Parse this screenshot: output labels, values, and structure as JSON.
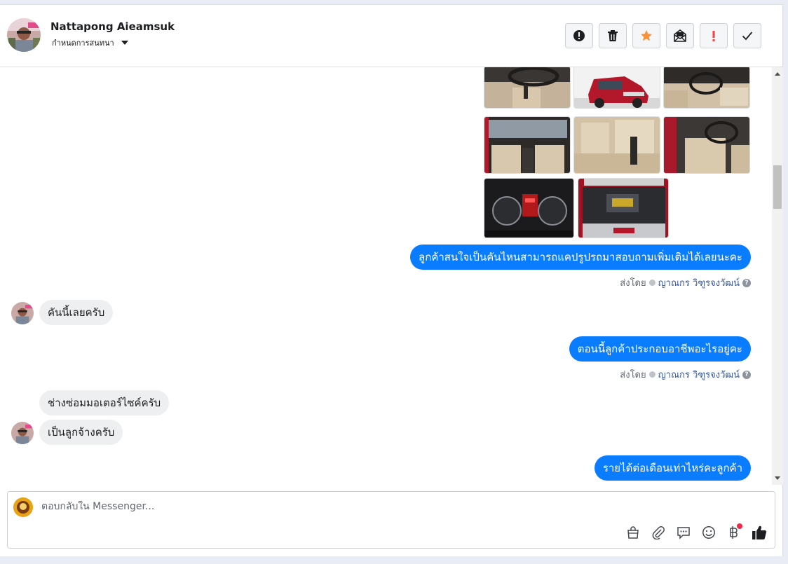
{
  "contact": {
    "name": "Nattapong Aieamsuk",
    "status_label": "กำหนดการสนทนา"
  },
  "header_buttons": [
    {
      "name": "spam-button",
      "icon": "alert-circle-icon"
    },
    {
      "name": "delete-button",
      "icon": "trash-icon"
    },
    {
      "name": "star-button",
      "icon": "star-icon",
      "color": "#f7923b"
    },
    {
      "name": "mark-unread-button",
      "icon": "envelope-open-icon"
    },
    {
      "name": "mark-important-button",
      "icon": "exclamation-icon",
      "color": "#fa3e3e"
    },
    {
      "name": "mark-done-button",
      "icon": "checkmark-icon"
    }
  ],
  "messages": {
    "out_1": "ลูกค้าสนใจเป็นคันไหนสามารถแคปรูปรถมาสอบถามเพิ่มเติมได้เลยนะคะ",
    "sent_by_1": "ส่งโดย",
    "agent_1": "ญาณกร วิฑูรจงวัฒน์",
    "in_1": "คันนี้เลยครับ",
    "out_2": "ตอนนี้ลูกค้าประกอบอาชีพอะไรอยู่คะ",
    "sent_by_2": "ส่งโดย",
    "agent_2": "ญาณกร วิฑูรจงวัฒน์",
    "in_2": "ช่างซ่อมมอเตอร์ไซค์ครับ",
    "in_3": "เป็นลูกจ้างครับ",
    "out_3": "รายได้ต่อเดือนเท่าไหร่คะลูกค้า"
  },
  "composer": {
    "placeholder": "ตอบกลับใน Messenger..."
  },
  "composer_tools": [
    "shop-bag-icon",
    "paperclip-icon",
    "saved-reply-icon",
    "emoji-icon",
    "baht-icon",
    "thumbs-up-icon"
  ],
  "colors": {
    "outgoing_bubble": "#0a7cff",
    "incoming_bubble": "#eeeff1",
    "agent_link": "#385898"
  }
}
